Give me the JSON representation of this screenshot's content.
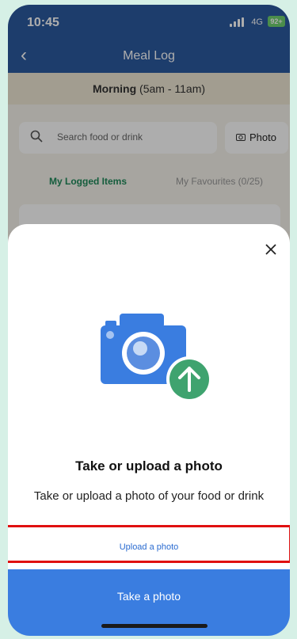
{
  "status": {
    "time": "10:45",
    "network": "4G",
    "battery": "92+"
  },
  "nav": {
    "back_icon": "chevron-left-icon",
    "title": "Meal Log"
  },
  "meal": {
    "name": "Morning",
    "range": " (5am - 11am)"
  },
  "search": {
    "placeholder": "Search food or drink"
  },
  "photo_button": {
    "label": "Photo"
  },
  "tabs": [
    {
      "label": "My Logged Items",
      "active": true
    },
    {
      "label": "My Favourites (0/25)",
      "active": false
    }
  ],
  "sheet": {
    "title": "Take or upload a photo",
    "description": "Take or upload a photo of your food or drink",
    "upload_label": "Upload a photo",
    "take_label": "Take a photo"
  },
  "colors": {
    "brand_blue": "#3a7de0",
    "header_blue": "#2c5aa0",
    "accent_green": "#1f8a5a",
    "highlight_red": "#e01010"
  }
}
